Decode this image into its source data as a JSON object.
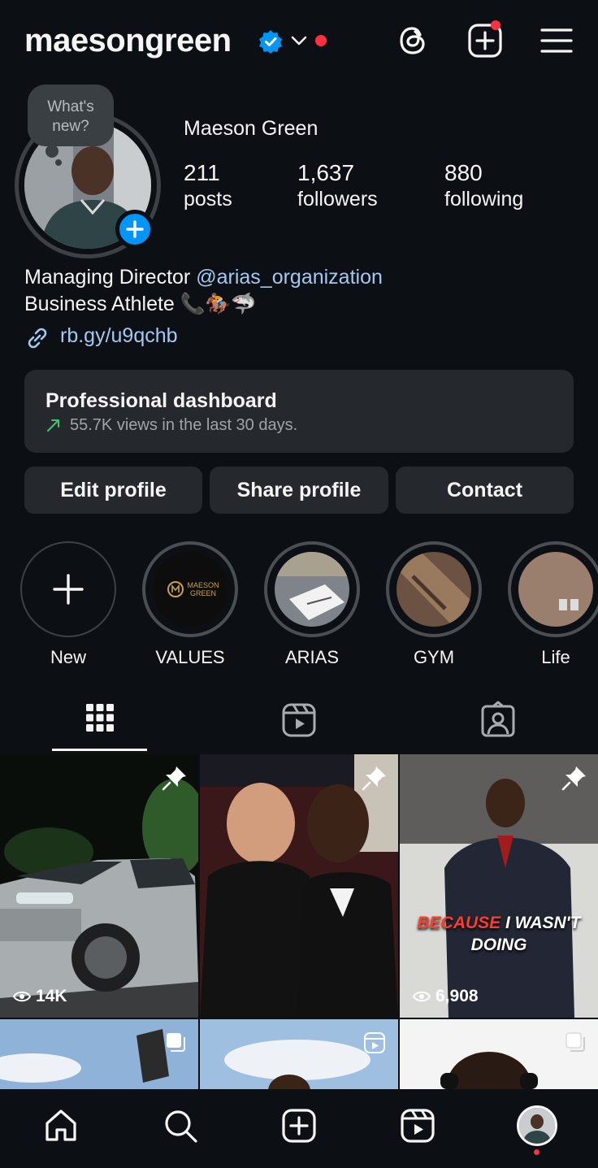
{
  "header": {
    "username": "maesongreen",
    "verified_icon": "verified-badge-icon",
    "accent_notification_color": "#ff3040"
  },
  "profile": {
    "note": "What's new?",
    "full_name": "Maeson Green",
    "stats": [
      {
        "value": "211",
        "label": "posts"
      },
      {
        "value": "1,637",
        "label": "followers"
      },
      {
        "value": "880",
        "label": "following"
      }
    ],
    "bio_line1_prefix": "Managing Director ",
    "bio_mention": "@arias_organization",
    "bio_line2": "Business Athlete 📞🏇🦈",
    "link": "rb.gy/u9qchb"
  },
  "dashboard": {
    "title": "Professional dashboard",
    "subtitle": "55.7K views in the last 30 days."
  },
  "buttons": {
    "edit": "Edit profile",
    "share": "Share profile",
    "contact": "Contact"
  },
  "highlights": [
    {
      "label": "New"
    },
    {
      "label": "VALUES",
      "thumb_text": "MAESON GREEN"
    },
    {
      "label": "ARIAS"
    },
    {
      "label": "GYM"
    },
    {
      "label": "Life"
    }
  ],
  "grid": {
    "posts": [
      {
        "views": "14K",
        "pinned": true
      },
      {
        "pinned": true
      },
      {
        "views": "6,908",
        "pinned": true,
        "caption_red": "BECAUSE",
        "caption_white": " I WASN'T",
        "caption_line2": "DOING"
      }
    ]
  },
  "colors": {
    "background": "#0c1014",
    "card": "#25292e",
    "link": "#a4c8f0",
    "brand_blue": "#0095f6"
  }
}
